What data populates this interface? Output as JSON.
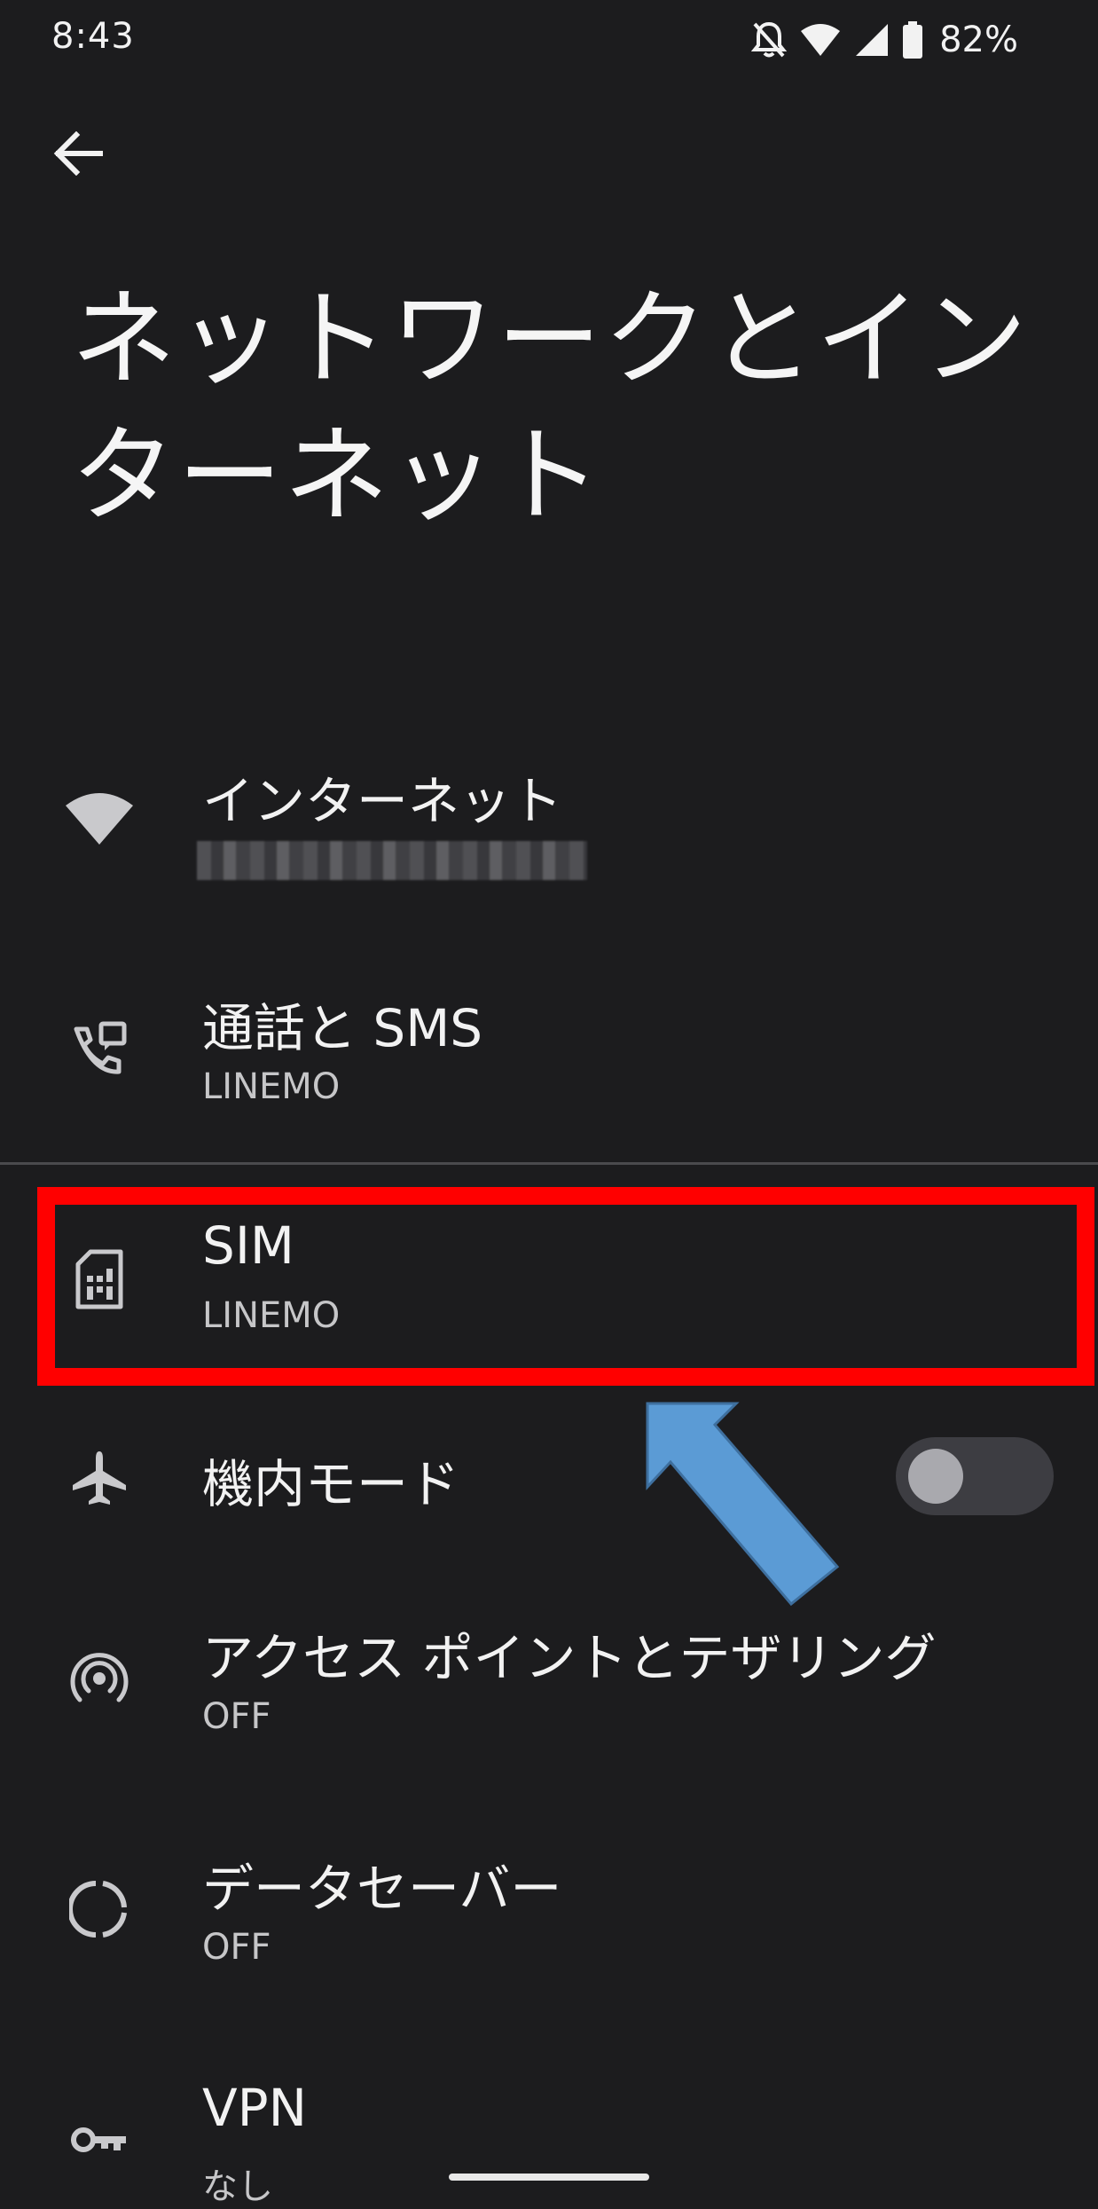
{
  "status_bar": {
    "time": "8:43",
    "battery_percent": "82%",
    "icons": [
      "bell-off-icon",
      "wifi-icon",
      "cell-signal-icon",
      "battery-icon"
    ]
  },
  "header": {
    "back_icon": "arrow-back-icon",
    "title": "ネットワークとインターネット"
  },
  "settings": {
    "internet": {
      "title": "インターネット",
      "icon": "wifi-icon"
    },
    "calls_sms": {
      "title": "通話と SMS",
      "subtitle": "LINEMO",
      "icon": "phone-message-icon"
    },
    "sim": {
      "title": "SIM",
      "subtitle": "LINEMO",
      "icon": "sim-card-icon"
    },
    "airplane_mode": {
      "title": "機内モード",
      "icon": "airplane-icon",
      "enabled": false
    },
    "hotspot": {
      "title": "アクセス ポイントとテザリング",
      "subtitle": "OFF",
      "icon": "hotspot-icon"
    },
    "data_saver": {
      "title": "データセーバー",
      "subtitle": "OFF",
      "icon": "data-saver-icon"
    },
    "vpn": {
      "title": "VPN",
      "subtitle": "なし",
      "icon": "key-icon"
    }
  },
  "colors": {
    "background": "#1c1c1e",
    "highlight": "#ff0000",
    "arrow": "#5b9bd5"
  }
}
